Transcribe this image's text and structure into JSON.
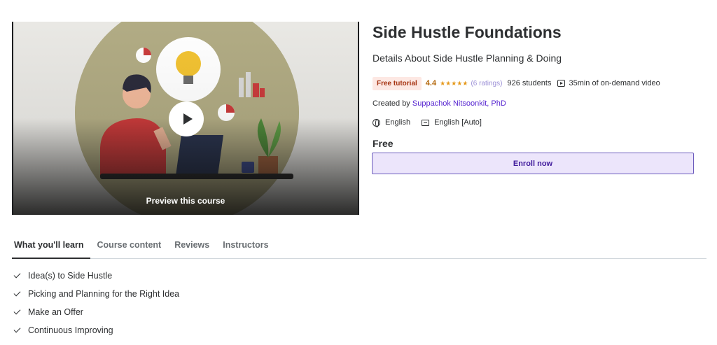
{
  "preview": {
    "label": "Preview this course"
  },
  "course": {
    "title": "Side Hustle Foundations",
    "subtitle": "Details About Side Hustle Planning & Doing",
    "badge": "Free tutorial",
    "rating": "4.4",
    "stars": "★★★★★",
    "ratings_count": "(6 ratings)",
    "students": "926 students",
    "video_length": "35min of on-demand video",
    "created_by_label": "Created by",
    "instructor": "Suppachok Nitsoonkit, PhD",
    "language": "English",
    "captions": "English [Auto]",
    "price": "Free",
    "enroll_label": "Enroll now"
  },
  "tabs": [
    {
      "label": "What you'll learn"
    },
    {
      "label": "Course content"
    },
    {
      "label": "Reviews"
    },
    {
      "label": "Instructors"
    }
  ],
  "learn": [
    "Idea(s) to Side Hustle",
    "Picking and Planning for the Right Idea",
    "Make an Offer",
    "Continuous Improving"
  ],
  "colors": {
    "accent": "#5624d0",
    "enroll_bg": "#ece5fb",
    "badge_bg": "#fde8e3",
    "rating": "#b4690e"
  }
}
